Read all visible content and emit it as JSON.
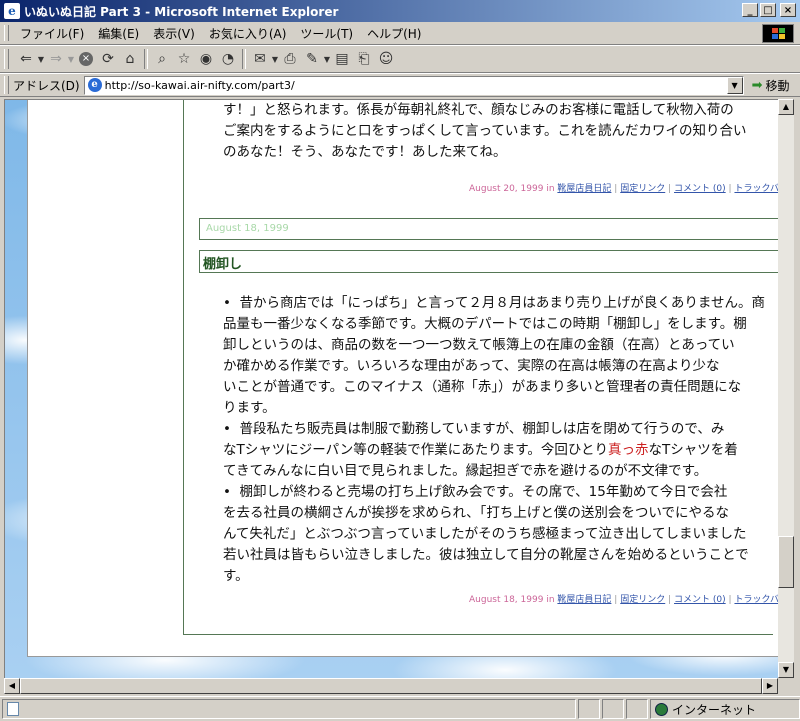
{
  "window": {
    "title": "いぬいぬ日記 Part 3 - Microsoft Internet Explorer",
    "minimize": "_",
    "maximize": "□",
    "close": "×"
  },
  "menu": {
    "items": [
      "ファイル(F)",
      "編集(E)",
      "表示(V)",
      "お気に入り(A)",
      "ツール(T)",
      "ヘルプ(H)"
    ]
  },
  "toolbar": {
    "buttons": [
      "back-icon",
      "forward-icon",
      "stop-icon",
      "refresh-icon",
      "home-icon",
      "search-icon",
      "favorites-icon",
      "history-icon",
      "mail-icon",
      "print-icon",
      "edit-icon",
      "discuss-icon",
      "messenger-icon"
    ]
  },
  "address": {
    "label": "アドレス(D)",
    "url": "http://so-kawai.air-nifty.com/part3/",
    "go_label": "移動"
  },
  "post1": {
    "lines": [
      "す！」と怒られます。係長が毎朝礼終礼で、顔なじみのお客様に電話して秋物入荷の",
      "ご案内をするようにと口をすっぱくして言っています。これを読んだカワイの知り合い",
      "のあなた！そう、あなたです！あした来てね。"
    ],
    "meta": {
      "date": "August 20, 1999",
      "in": "in",
      "category": "靴屋店員日記",
      "permalink": "固定リンク",
      "comments": "コメント (0)",
      "trackback": "トラックバック"
    }
  },
  "post2": {
    "date_header": "August 18, 1999",
    "title": "棚卸し",
    "paragraphs": [
      {
        "lines": [
          "昔から商店では「にっぱち」と言って２月８月はあまり売り上げが良くありません。商",
          "品量も一番少なくなる季節です。大概のデパートではこの時期「棚卸し」をします。棚",
          "卸しというのは、商品の数を一つ一つ数えて帳簿上の在庫の金額（在高）とあってい",
          "か確かめる作業です。いろいろな理由があって、実際の在高は帳簿の在高より少な",
          "いことが普通です。このマイナス（通称「赤」）があまり多いと管理者の責任問題にな",
          "ります。"
        ]
      },
      {
        "line1": "普段私たち販売員は制服で勤務していますが、棚卸しは店を閉めて行うので、み",
        "line2_before": "なTシャツにジーパン等の軽装で作業にあたります。今回ひとり",
        "line2_red": "真っ赤",
        "line2_after": "なTシャツを着",
        "line3": "てきてみんなに白い目で見られました。縁起担ぎで赤を避けるのが不文律です。"
      },
      {
        "lines": [
          "棚卸しが終わると売場の打ち上げ飲み会です。その席で、15年勤めて今日で会社",
          "を去る社員の横綱さんが挨拶を求められ、「打ち上げと僕の送別会をついでにやるな",
          "んて失礼だ」とぶつぶつ言っていましたがそのうち感極まって泣き出してしまいました",
          "若い社員は皆もらい泣きしました。彼は独立して自分の靴屋さんを始めるということで",
          "す。"
        ]
      }
    ],
    "meta": {
      "date": "August 18, 1999",
      "in": "in",
      "category": "靴屋店員日記",
      "permalink": "固定リンク",
      "comments": "コメント (0)",
      "trackback": "トラックバック"
    }
  },
  "status": {
    "text": "",
    "zone": "インターネット"
  },
  "scroll": {
    "vertical_fraction": 0.85,
    "horizontal_fraction": 0.0
  }
}
